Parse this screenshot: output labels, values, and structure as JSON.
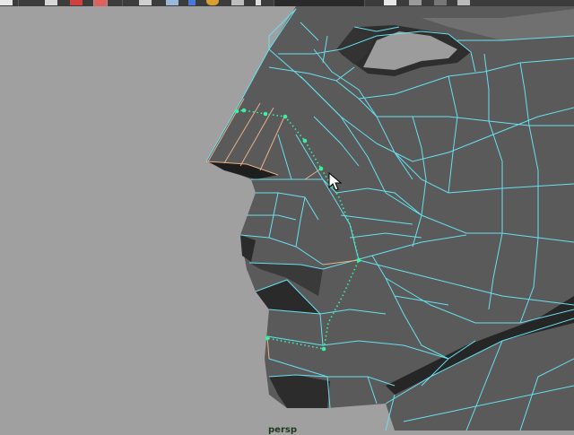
{
  "toolbar": {
    "icons": [
      "select-tool-icon",
      "lasso-tool-icon",
      "paint-select-icon",
      "grid-icon",
      "camera-icon",
      "sphere-icon",
      "cube-icon",
      "marker-icon",
      "render-icon",
      "ipr-icon",
      "render-settings-icon",
      "hypershade-icon"
    ]
  },
  "viewport": {
    "camera": "persp",
    "background_color": "#a0a0a0",
    "mesh_fill": "#555555",
    "wireframe_color": "#66e0f0",
    "selected_edge_color": "#e8b088",
    "component_color": "#3cf0a0"
  }
}
